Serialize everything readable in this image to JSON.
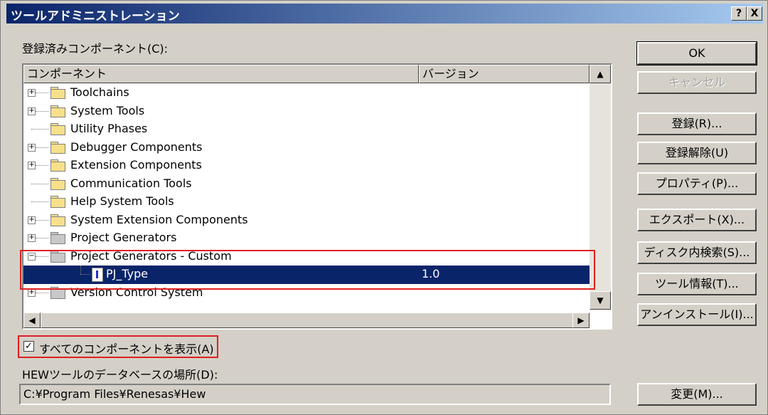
{
  "window": {
    "title": "ツールアドミニストレーション",
    "help_btn": "?",
    "close_btn": "X"
  },
  "components_label": "登録済みコンポーネント(C):",
  "components_label_key": "C",
  "table": {
    "col_component": "コンポーネント",
    "col_version": "バージョン",
    "rows": [
      {
        "name": "Toolchains",
        "version": "",
        "expander": "+",
        "icon": "folder-icon"
      },
      {
        "name": "System Tools",
        "version": "",
        "expander": "+",
        "icon": "folder-icon"
      },
      {
        "name": "Utility Phases",
        "version": "",
        "expander": "",
        "icon": "folder-icon"
      },
      {
        "name": "Debugger Components",
        "version": "",
        "expander": "+",
        "icon": "folder-icon"
      },
      {
        "name": "Extension Components",
        "version": "",
        "expander": "+",
        "icon": "folder-icon"
      },
      {
        "name": "Communication Tools",
        "version": "",
        "expander": "",
        "icon": "folder-icon"
      },
      {
        "name": "Help System Tools",
        "version": "",
        "expander": "",
        "icon": "folder-icon"
      },
      {
        "name": "System Extension Components",
        "version": "",
        "expander": "+",
        "icon": "folder-icon"
      },
      {
        "name": "Project Generators",
        "version": "",
        "expander": "+",
        "icon": "folder-gray-icon"
      },
      {
        "name": "Project Generators - Custom",
        "version": "",
        "expander": "−",
        "icon": "folder-open-icon"
      },
      {
        "name": "PJ_Type",
        "version": "1.0",
        "expander": "",
        "icon": "document-icon",
        "selected": true
      },
      {
        "name": "Version Control System",
        "version": "",
        "expander": "+",
        "icon": "folder-gray-icon"
      }
    ]
  },
  "buttons": {
    "ok": "OK",
    "cancel": "キャンセル",
    "register": "登録(R)...",
    "unregister": "登録解除(U)",
    "properties": "プロパティ(P)...",
    "export": "エクスポート(X)...",
    "disk_search": "ディスク内検索(S)...",
    "tool_info": "ツール情報(T)...",
    "uninstall": "アンインストール(I)...",
    "change": "変更(M)..."
  },
  "show_all_checkbox": {
    "label": "すべてのコンポーネントを表示(A)",
    "checked": true,
    "mark": "✓"
  },
  "db_location_label": "HEWツールのデータベースの場所(D):",
  "db_location_value": "C:¥Program Files¥Renesas¥Hew",
  "colors": {
    "title_start": "#0a246a",
    "title_end": "#a6caf0",
    "selection": "#0a246a",
    "highlight": "#e02020"
  }
}
